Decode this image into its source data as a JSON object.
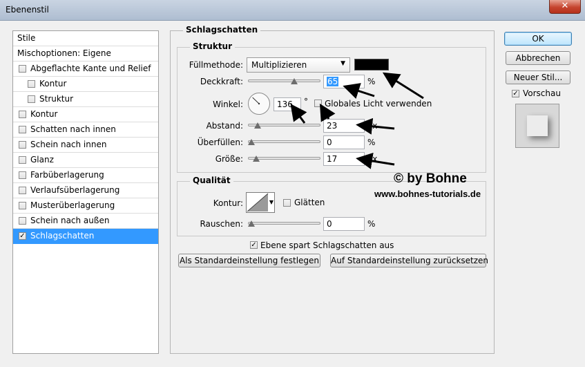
{
  "window": {
    "title": "Ebenenstil",
    "close_glyph": "✕"
  },
  "styles_list": {
    "items": [
      {
        "label": "Stile",
        "checkbox": false,
        "checked": false,
        "indent": 0,
        "selected": false
      },
      {
        "label": "Mischoptionen: Eigene",
        "checkbox": false,
        "checked": false,
        "indent": 0,
        "selected": false
      },
      {
        "label": "Abgeflachte Kante und Relief",
        "checkbox": true,
        "checked": false,
        "indent": 0,
        "selected": false
      },
      {
        "label": "Kontur",
        "checkbox": true,
        "checked": false,
        "indent": 1,
        "selected": false
      },
      {
        "label": "Struktur",
        "checkbox": true,
        "checked": false,
        "indent": 1,
        "selected": false
      },
      {
        "label": "Kontur",
        "checkbox": true,
        "checked": false,
        "indent": 0,
        "selected": false
      },
      {
        "label": "Schatten nach innen",
        "checkbox": true,
        "checked": false,
        "indent": 0,
        "selected": false
      },
      {
        "label": "Schein nach innen",
        "checkbox": true,
        "checked": false,
        "indent": 0,
        "selected": false
      },
      {
        "label": "Glanz",
        "checkbox": true,
        "checked": false,
        "indent": 0,
        "selected": false
      },
      {
        "label": "Farbüberlagerung",
        "checkbox": true,
        "checked": false,
        "indent": 0,
        "selected": false
      },
      {
        "label": "Verlaufsüberlagerung",
        "checkbox": true,
        "checked": false,
        "indent": 0,
        "selected": false
      },
      {
        "label": "Musterüberlagerung",
        "checkbox": true,
        "checked": false,
        "indent": 0,
        "selected": false
      },
      {
        "label": "Schein nach außen",
        "checkbox": true,
        "checked": false,
        "indent": 0,
        "selected": false
      },
      {
        "label": "Schlagschatten",
        "checkbox": true,
        "checked": true,
        "indent": 0,
        "selected": true
      }
    ]
  },
  "drop_shadow": {
    "section_title": "Schlagschatten",
    "structure": {
      "title": "Struktur",
      "blend_mode_label": "Füllmethode:",
      "blend_mode_value": "Multiplizieren",
      "shadow_color": "#000000",
      "opacity_label": "Deckkraft:",
      "opacity_value": "65",
      "opacity_unit": "%",
      "opacity_fraction": 0.65,
      "angle_label": "Winkel:",
      "angle_value": "136",
      "angle_unit": "°",
      "angle_degrees": 136,
      "global_light_label": "Globales Licht verwenden",
      "global_light_checked": false,
      "distance_label": "Abstand:",
      "distance_value": "23",
      "distance_unit": "Px",
      "distance_fraction": 0.09,
      "spread_label": "Überfüllen:",
      "spread_value": "0",
      "spread_unit": "%",
      "spread_fraction": 0.0,
      "size_label": "Größe:",
      "size_value": "17",
      "size_unit": "Px",
      "size_fraction": 0.07
    },
    "quality": {
      "title": "Qualität",
      "contour_label": "Kontur:",
      "antialias_label": "Glätten",
      "antialias_checked": false,
      "noise_label": "Rauschen:",
      "noise_value": "0",
      "noise_unit": "%",
      "noise_fraction": 0.0
    },
    "layer_knocks_out_label": "Ebene spart Schlagschatten aus",
    "layer_knocks_out_checked": true,
    "make_default_label": "Als Standardeinstellung festlegen",
    "reset_default_label": "Auf Standardeinstellung zurücksetzen"
  },
  "actions": {
    "ok_label": "OK",
    "cancel_label": "Abbrechen",
    "new_style_label": "Neuer Stil...",
    "preview_label": "Vorschau",
    "preview_checked": true
  },
  "watermark": {
    "line1": "© by Bohne",
    "line2": "www.bohnes-tutorials.de"
  }
}
